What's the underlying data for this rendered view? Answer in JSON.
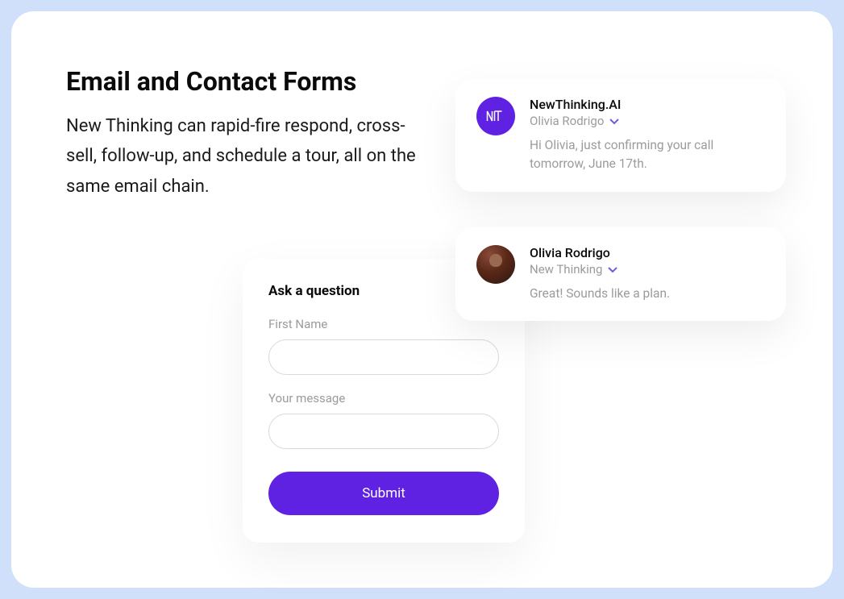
{
  "heading": "Email and Contact Forms",
  "description": "New Thinking can rapid-fire respond, cross-sell, follow-up, and schedule a tour, all on the same email chain.",
  "form": {
    "title": "Ask a question",
    "first_name_label": "First Name",
    "message_label": "Your message",
    "submit_label": "Submit"
  },
  "messages": [
    {
      "avatar": "ai-logo",
      "sender": "NewThinking.AI",
      "recipient": "Olivia Rodrigo",
      "body": "Hi Olivia, just confirming your call tomorrow, June 17th."
    },
    {
      "avatar": "person-photo",
      "sender": "Olivia Rodrigo",
      "recipient": "New Thinking",
      "body": "Great! Sounds like a plan."
    }
  ],
  "colors": {
    "accent": "#6022e2",
    "bg": "#d0dffa"
  }
}
